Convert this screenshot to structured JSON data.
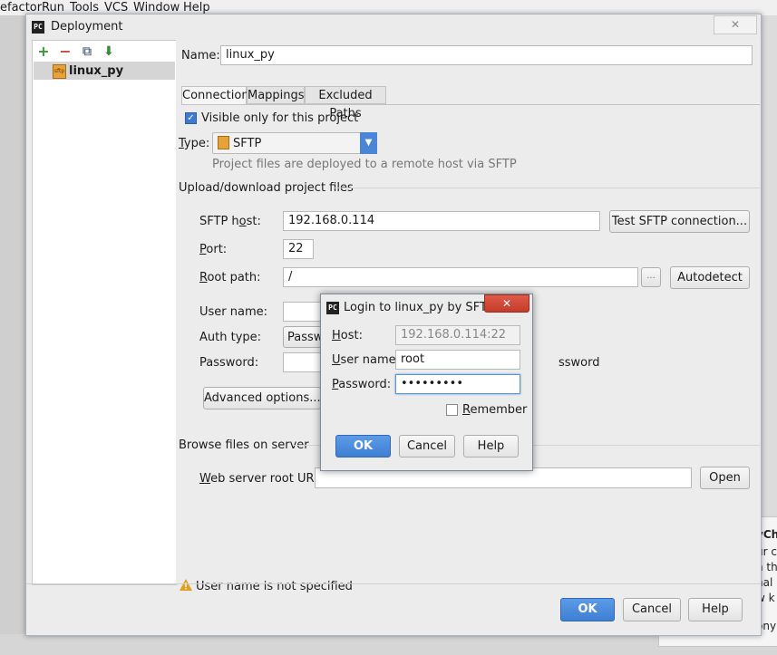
{
  "ide": {
    "menu": [
      "efactor",
      "Run",
      "Tools",
      "VCS",
      "Window",
      "Help"
    ],
    "notification_lines": [
      "yCh",
      "ur c",
      "n th",
      "nal",
      "w k",
      "ony"
    ]
  },
  "dialog": {
    "title": "Deployment",
    "close_label": "✕",
    "logo_text": "PC",
    "toolbar": {
      "add": "+",
      "remove": "−",
      "copy": "⧉",
      "default": "⬇"
    },
    "tree": {
      "server_name": "linux_py",
      "icon_text": "sftp"
    },
    "name_label": "Name:",
    "name_value": "linux_py",
    "tabs": [
      "Connection",
      "Mappings",
      "Excluded Paths"
    ],
    "visible_only_label": "Visible only for this project",
    "type_label": "Type:",
    "type_value": "SFTP",
    "type_hint": "Project files are deployed to a remote host via SFTP",
    "upload_section": "Upload/download project files",
    "sftp_host_label": "SFTP host:",
    "sftp_host_value": "192.168.0.114",
    "test_button": "Test SFTP connection...",
    "port_label": "Port:",
    "port_value": "22",
    "root_path_label": "Root path:",
    "root_path_value": "/",
    "browse_button": "...",
    "autodetect_button": "Autodetect",
    "user_name_label": "User name:",
    "auth_type_label": "Auth type:",
    "auth_type_value": "Passwo",
    "password_label": "Password:",
    "save_password_tail": "ssword",
    "advanced_button": "Advanced options...",
    "browse_section": "Browse files on server",
    "web_root_label": "Web server root URL:",
    "open_button": "Open",
    "warning_text": "User name is not specified",
    "ok_button": "OK",
    "cancel_button": "Cancel",
    "help_button": "Help"
  },
  "login": {
    "title": "Login to linux_py by SFTP",
    "host_label": "Host:",
    "host_value": "192.168.0.114:22",
    "user_label": "User name:",
    "user_value": "root",
    "password_label": "Password:",
    "password_value": "•••••••••",
    "remember_label": "Remember",
    "ok_button": "OK",
    "cancel_button": "Cancel",
    "help_button": "Help"
  },
  "colors": {
    "accent": "#3f7fd3",
    "close_red": "#c43b2a",
    "warning": "#e0a020"
  }
}
